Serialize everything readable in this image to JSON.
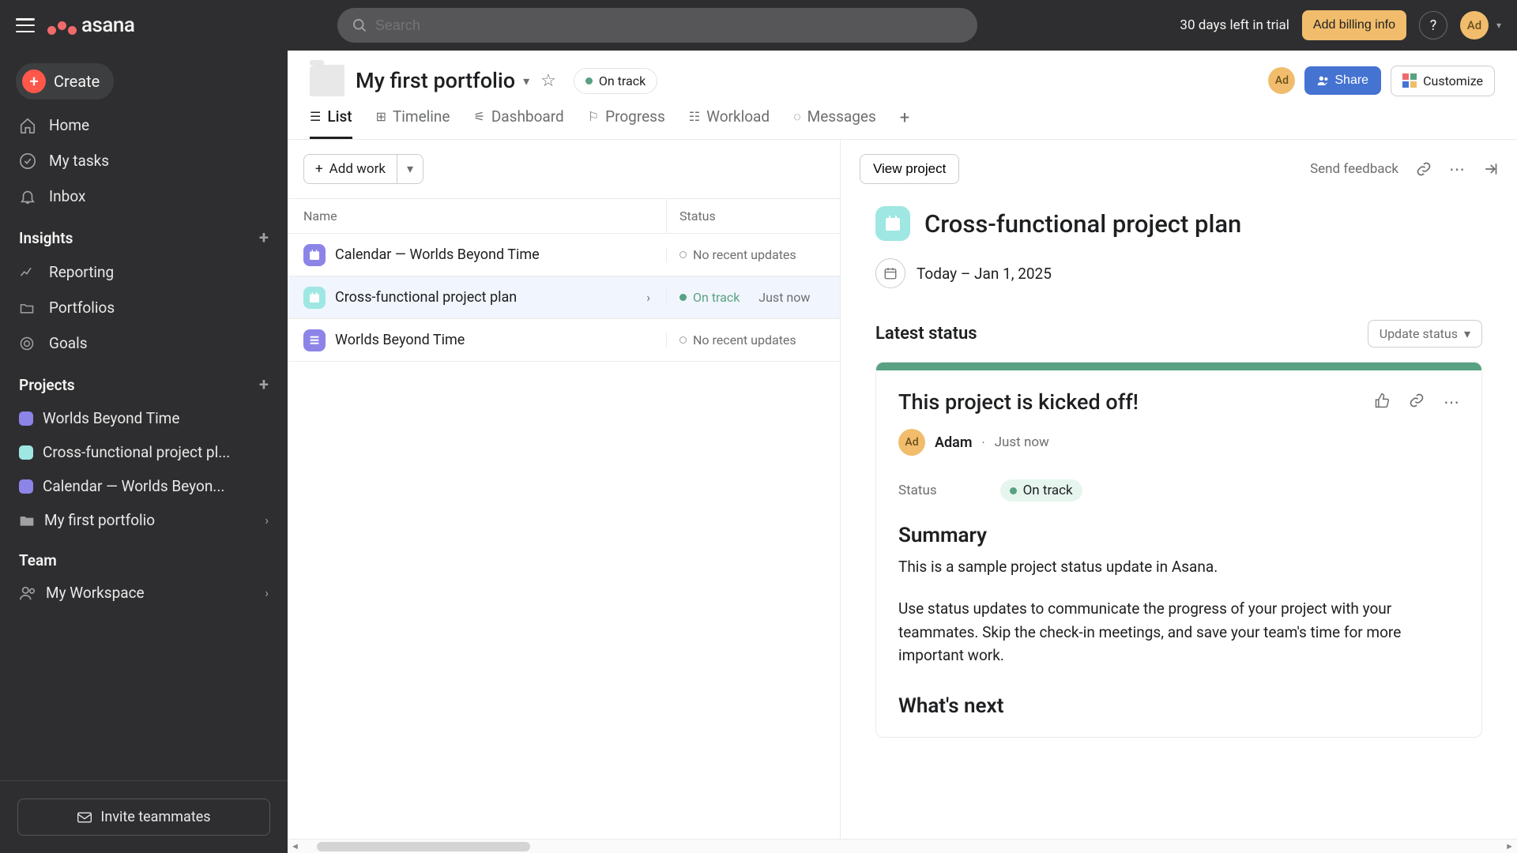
{
  "topbar": {
    "search_placeholder": "Search",
    "trial_text": "30 days left in trial",
    "billing_label": "Add billing info",
    "help_label": "?",
    "avatar_initials": "Ad"
  },
  "sidebar": {
    "create_label": "Create",
    "nav": {
      "home": "Home",
      "mytasks": "My tasks",
      "inbox": "Inbox"
    },
    "insights_header": "Insights",
    "insights": {
      "reporting": "Reporting",
      "portfolios": "Portfolios",
      "goals": "Goals"
    },
    "projects_header": "Projects",
    "projects": [
      {
        "name": "Worlds Beyond Time",
        "color": "#8d84e8"
      },
      {
        "name": "Cross-functional project pl...",
        "color": "#9ee7e3"
      },
      {
        "name": "Calendar — Worlds Beyon...",
        "color": "#8d84e8"
      },
      {
        "name": "My first portfolio",
        "color": "#e8e8e8",
        "is_folder": true,
        "chevron": true
      }
    ],
    "team_header": "Team",
    "team_item": "My Workspace",
    "invite_label": "Invite teammates"
  },
  "portfolio_header": {
    "title": "My first portfolio",
    "status": "On track",
    "avatar": "Ad",
    "share_label": "Share",
    "customize_label": "Customize"
  },
  "tabs": [
    "List",
    "Timeline",
    "Dashboard",
    "Progress",
    "Workload",
    "Messages"
  ],
  "list": {
    "addwork_label": "Add work",
    "col_name": "Name",
    "col_status": "Status",
    "rows": [
      {
        "name": "Calendar — Worlds Beyond Time",
        "color": "#8d84e8",
        "status_text": "No recent updates",
        "hollow": true
      },
      {
        "name": "Cross-functional project plan",
        "color": "#9ee7e3",
        "status_text": "On track",
        "time": "Just now",
        "selected": true,
        "green": true
      },
      {
        "name": "Worlds Beyond Time",
        "color": "#8d84e8",
        "status_text": "No recent updates",
        "hollow": true
      }
    ]
  },
  "detail": {
    "view_project": "View project",
    "send_feedback": "Send feedback",
    "title": "Cross-functional project plan",
    "date_text": "Today – Jan 1, 2025",
    "latest_status_header": "Latest status",
    "update_status_label": "Update status",
    "card": {
      "title": "This project is kicked off!",
      "author_initials": "Ad",
      "author_name": "Adam",
      "author_time": "Just now",
      "status_label": "Status",
      "status_value": "On track",
      "summary_header": "Summary",
      "summary_p1": "This is a sample project status update in Asana.",
      "summary_p2": "Use status updates to communicate the progress of your project with your teammates. Skip the check-in meetings, and save your team's time for more important work.",
      "whats_next": "What's next"
    }
  }
}
